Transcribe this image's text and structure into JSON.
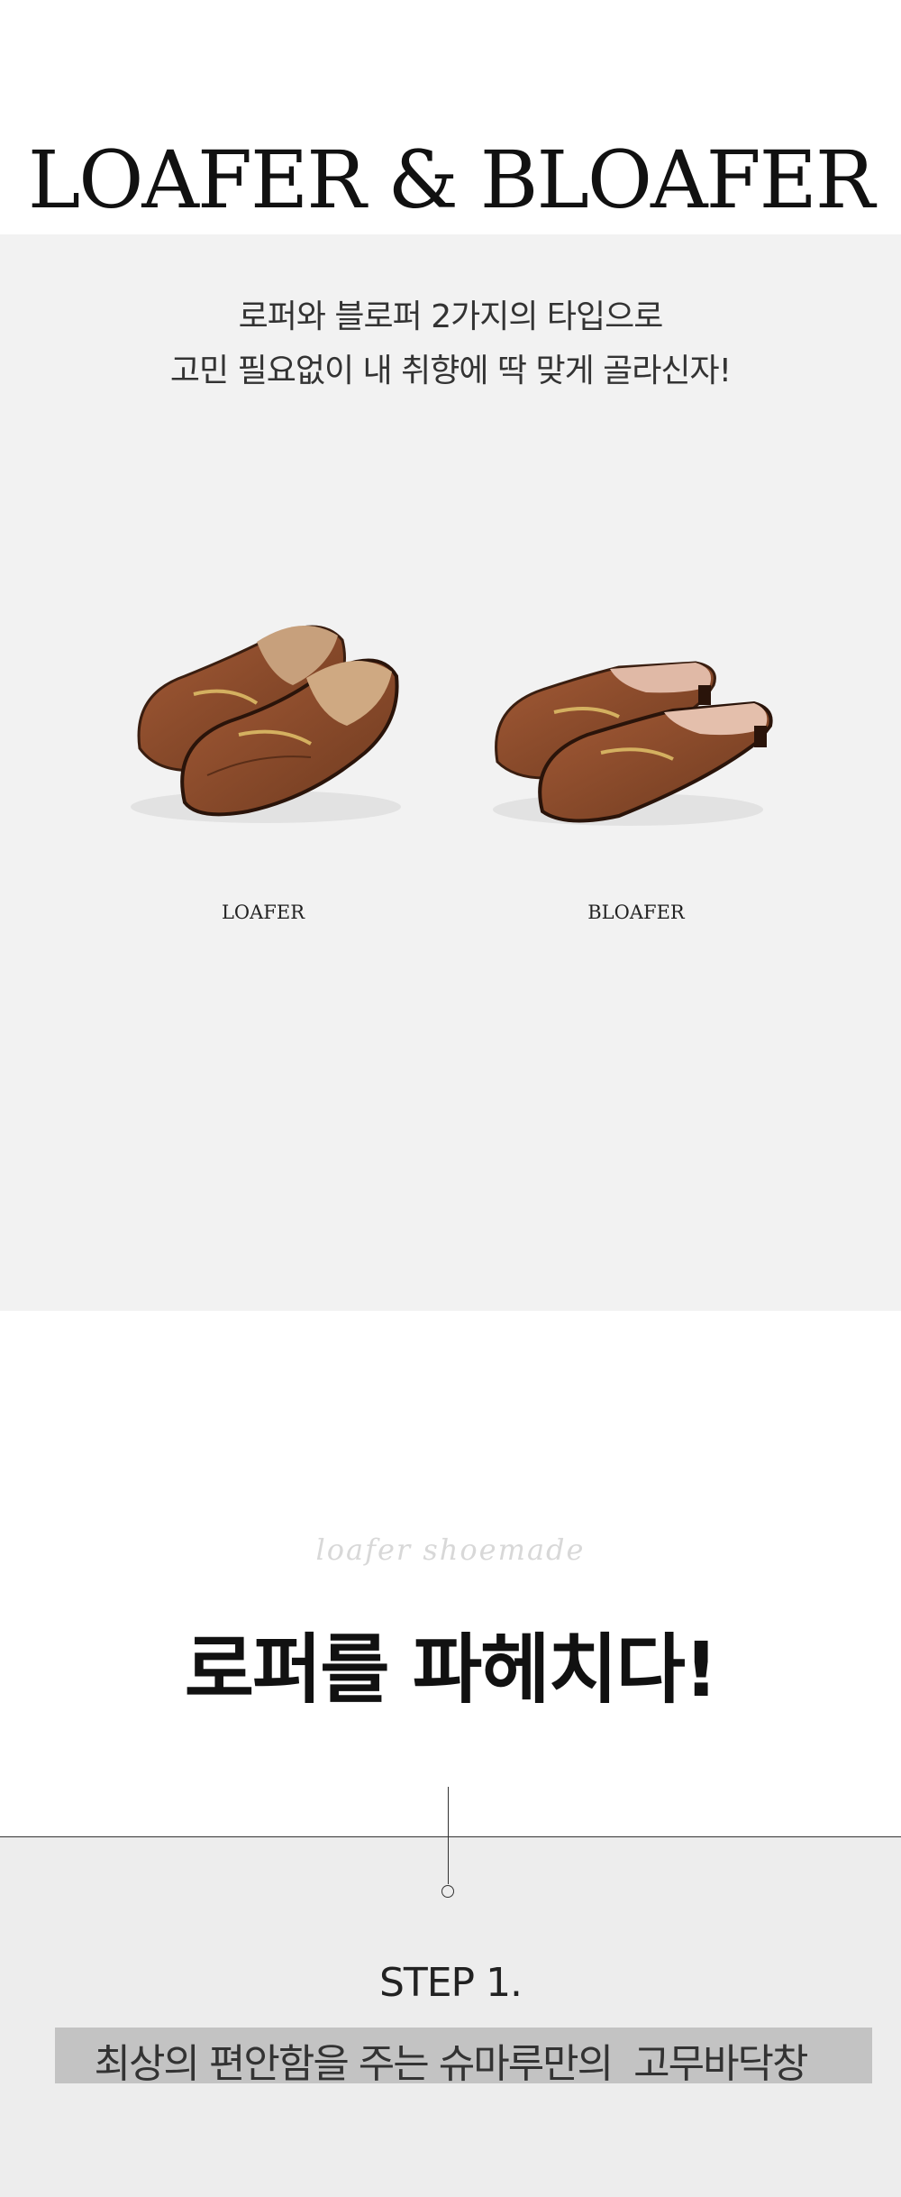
{
  "hero": {
    "title": "LOAFER & BLOAFER",
    "description_line1": "로퍼와 블로퍼 2가지의 타입으로",
    "description_line2": "고민 필요없이 내 취향에 딱 맞게 골라신자!"
  },
  "products": [
    {
      "label": "LOAFER",
      "image_icon": "loafer-shoe-pair-image"
    },
    {
      "label": "BLOAFER",
      "image_icon": "bloafer-shoe-pair-image"
    }
  ],
  "detail": {
    "script_text": "loafer shoemade",
    "heading": "로퍼를  파헤치다!",
    "step_label": "STEP 1.",
    "step_description": "최상의 편안함을 주는 슈마루만의  고무바닥창"
  },
  "colors": {
    "panel_gray": "#f2f2f2",
    "leather_brown": "#8a4a2a",
    "highlight_gray": "#c3c3c3"
  }
}
